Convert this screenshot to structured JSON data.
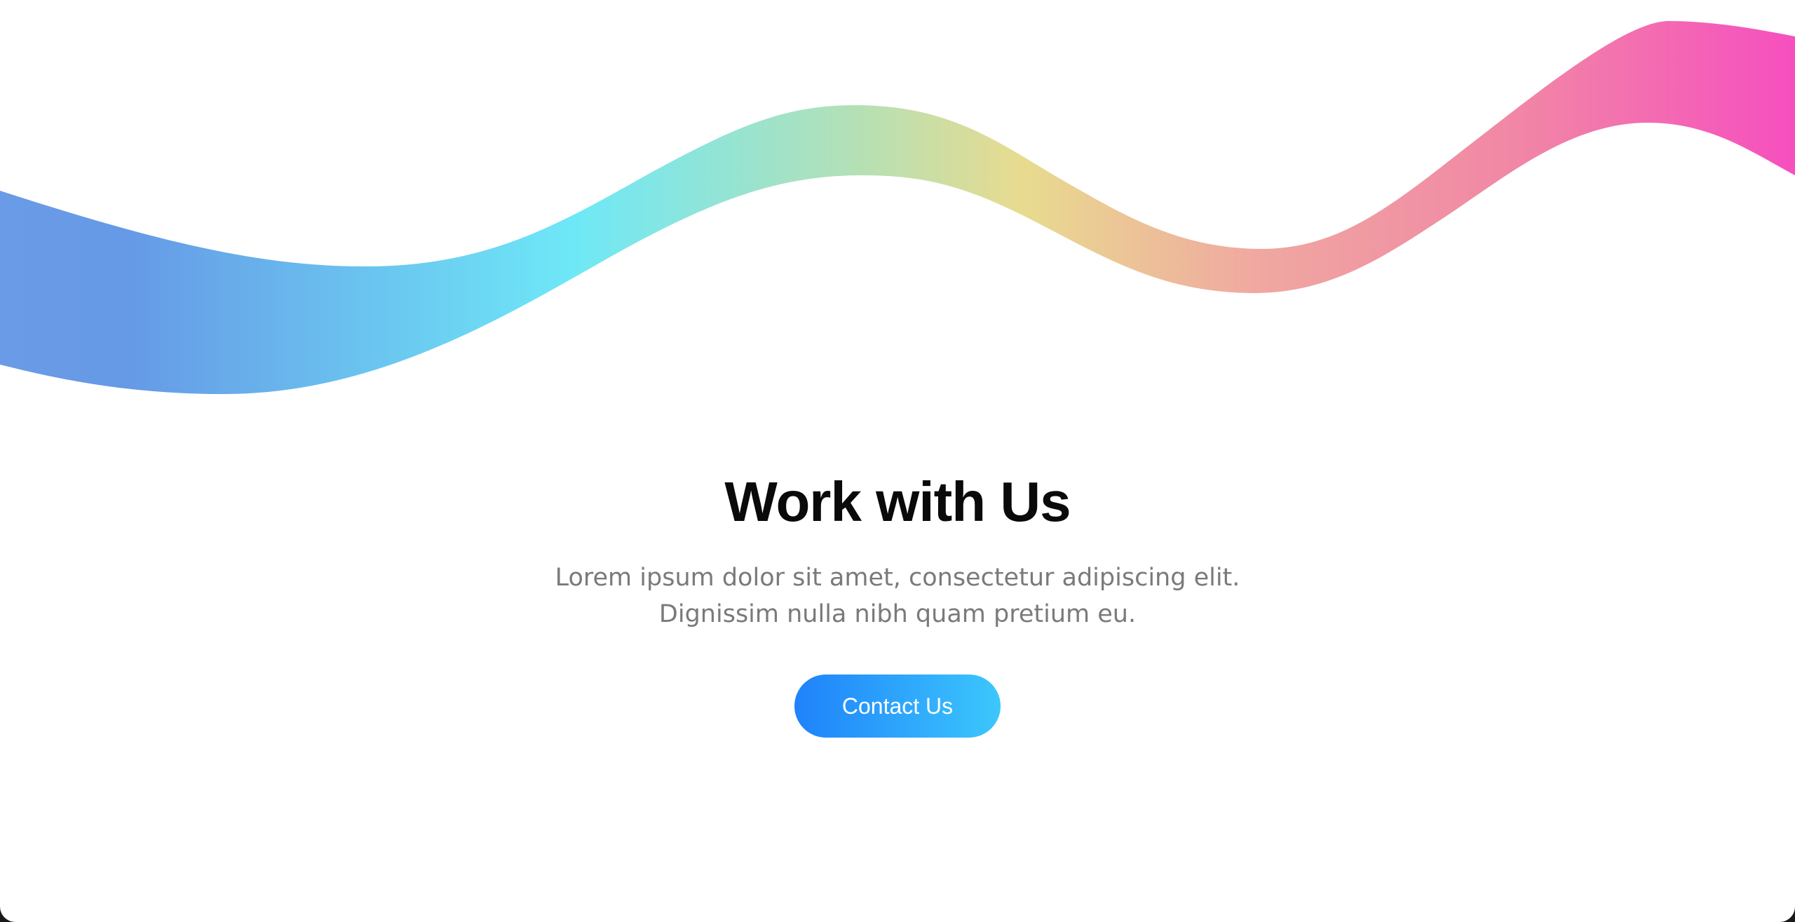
{
  "hero": {
    "title": "Work with Us",
    "subtitle_line1": "Lorem ipsum dolor sit amet, consectetur adipiscing elit.",
    "subtitle_line2": "Dignissim nulla nibh quam pretium eu.",
    "cta_label": "Contact Us"
  },
  "colors": {
    "wave_gradient": [
      "#6a9be6",
      "#6ee8f7",
      "#e8db8f",
      "#f09ea0",
      "#f64fbf"
    ],
    "cta_gradient": [
      "#1f82fb",
      "#3cc7fc"
    ],
    "title": "#0a0a0a",
    "subtitle": "#7a7a7a"
  }
}
